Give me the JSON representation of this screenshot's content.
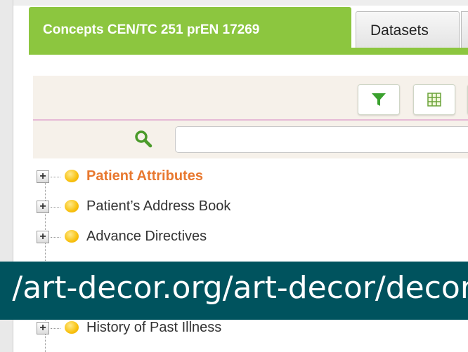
{
  "tabs": [
    {
      "label": "Concepts CEN/TC 251 prEN 17269"
    },
    {
      "label": "Datasets"
    }
  ],
  "toolbar": {
    "filter_icon": "filter-icon",
    "grid_icon": "grid-icon"
  },
  "search": {
    "value": "",
    "icon": "search-icon"
  },
  "tree": {
    "items": [
      {
        "label": "Patient Attributes",
        "selected": true
      },
      {
        "label": "Patient’s Address Book"
      },
      {
        "label": "Advance Directives"
      },
      {
        "label": "History of Past Illness"
      }
    ]
  },
  "banner": {
    "text": "/art-decor.org/art-decor/decor-"
  },
  "colors": {
    "tab_active": "#8cc63f",
    "toolbar_bg": "#f6f1ea",
    "selected_item": "#e8782f",
    "banner_bg": "#00535e"
  }
}
